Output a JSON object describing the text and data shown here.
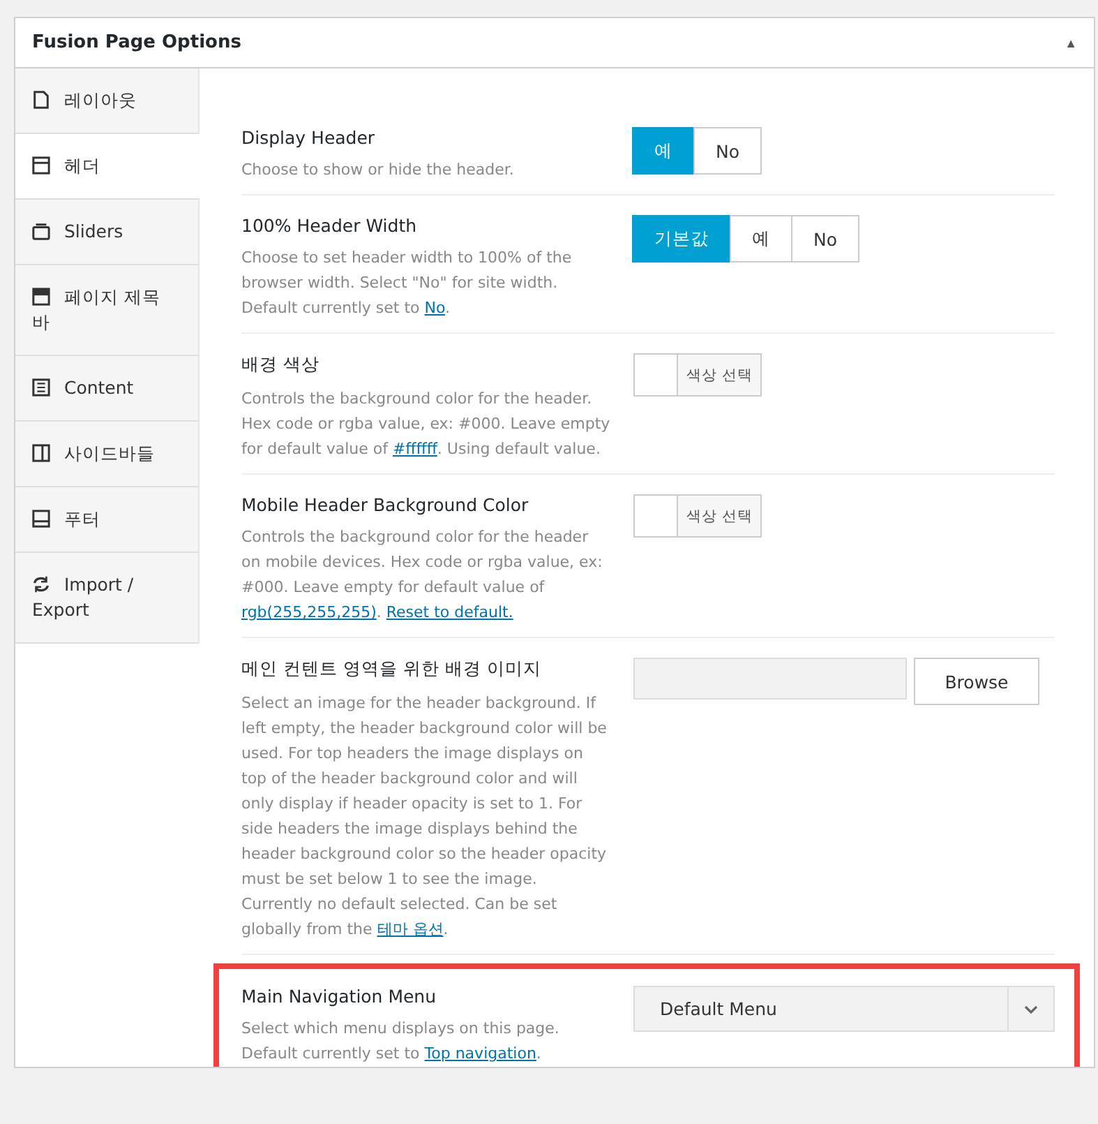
{
  "panel": {
    "title": "Fusion Page Options",
    "collapse_glyph": "▲"
  },
  "tabs": [
    {
      "label": "레이아웃",
      "selected": false
    },
    {
      "label": "헤더",
      "selected": true
    },
    {
      "label": "Sliders",
      "selected": false
    },
    {
      "label": "페이지 제목 바",
      "selected": false
    },
    {
      "label": "Content",
      "selected": false
    },
    {
      "label": "사이드바들",
      "selected": false
    },
    {
      "label": "푸터",
      "selected": false
    },
    {
      "label": "Import / Export",
      "selected": false
    }
  ],
  "options": [
    {
      "kind": "toggle",
      "label": "Display Header",
      "description": [
        {
          "kind": "text",
          "text": "Choose to show or hide the header."
        }
      ],
      "choices": [
        {
          "label": "예",
          "selected": true
        },
        {
          "label": "No",
          "selected": false
        }
      ]
    },
    {
      "kind": "toggle",
      "label": "100% Header Width",
      "description": [
        {
          "kind": "text",
          "text": "Choose to set header width to 100% of the browser width. Select \"No\" for site width. Default currently set to "
        },
        {
          "kind": "link",
          "text": "No"
        },
        {
          "kind": "text",
          "text": "."
        }
      ],
      "choices": [
        {
          "label": "기본값",
          "selected": true
        },
        {
          "label": "예",
          "selected": false
        },
        {
          "label": "No",
          "selected": false
        }
      ]
    },
    {
      "kind": "color",
      "label": "배경 색상",
      "description": [
        {
          "kind": "text",
          "text": "Controls the background color for the header. Hex code or rgba value, ex: #000. Leave empty for default value of "
        },
        {
          "kind": "link",
          "text": "#ffffff"
        },
        {
          "kind": "text",
          "text": ". Using default value."
        }
      ],
      "button": "색상 선택"
    },
    {
      "kind": "color",
      "label": "Mobile Header Background Color",
      "description": [
        {
          "kind": "text",
          "text": "Controls the background color for the header on mobile devices. Hex code or rgba value, ex: #000. Leave empty for default value of "
        },
        {
          "kind": "link",
          "text": "rgb(255,255,255)"
        },
        {
          "kind": "text",
          "text": ". "
        },
        {
          "kind": "link",
          "text": "Reset to default."
        }
      ],
      "button": "색상 선택"
    },
    {
      "kind": "upload",
      "label": "메인 컨텐트 영역을 위한 배경 이미지",
      "description": [
        {
          "kind": "text",
          "text": "Select an image for the header background. If left empty, the header background color will be used. For top headers the image displays on top of the header background color and will only display if header opacity is set to 1. For side headers the image displays behind the header background color so the header opacity must be set below 1 to see the image. Currently no default selected. Can be set globally from the "
        },
        {
          "kind": "link",
          "text": "테마 옵션"
        },
        {
          "kind": "text",
          "text": "."
        }
      ],
      "button": "Browse"
    },
    {
      "kind": "select",
      "label": "Main Navigation Menu",
      "highlighted": true,
      "description": [
        {
          "kind": "text",
          "text": "Select which menu displays on this page. Default currently set to "
        },
        {
          "kind": "link",
          "text": "Top navigation"
        },
        {
          "kind": "text",
          "text": "."
        }
      ],
      "value": "Default Menu"
    }
  ]
}
